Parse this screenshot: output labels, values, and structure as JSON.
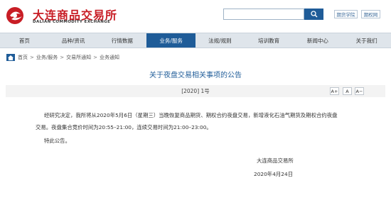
{
  "header": {
    "logo_cn": "大连商品交易所",
    "logo_en": "DALIAN COMMODITY EXCHANGE",
    "search_placeholder": "",
    "links": [
      "期货学院",
      "期权网"
    ]
  },
  "nav": {
    "items": [
      "首页",
      "品种/资讯",
      "行情数据",
      "业务/服务",
      "法规/规则",
      "培训教育",
      "新闻中心",
      "关于我们"
    ],
    "active_index": 3
  },
  "breadcrumb": {
    "items": [
      "首页",
      "业务/服务",
      "交易所通知",
      "业务通知"
    ],
    "separator": ">"
  },
  "article": {
    "title": "关于夜盘交易相关事项的公告",
    "doc_number": "[2020] 1号",
    "font_controls": [
      "A+",
      "A",
      "A−"
    ],
    "paragraphs": [
      "经研究决定，我所将从2020年5月6日（星期三）当晚恢复商品期货、期权合约夜盘交易，新增液化石油气期货及期权合约夜盘",
      "交易。夜盘集合竞价时间为20:55–21:00，连续交易时间为21:00–23:00。",
      "特此公告。"
    ],
    "signature": "大连商品交易所",
    "date": "2020年4月24日"
  },
  "colors": {
    "brand_red": "#c81d25",
    "nav_blue": "#1f5c98",
    "nav_bg": "#dfe5eb",
    "title_blue": "#1f5c98"
  }
}
